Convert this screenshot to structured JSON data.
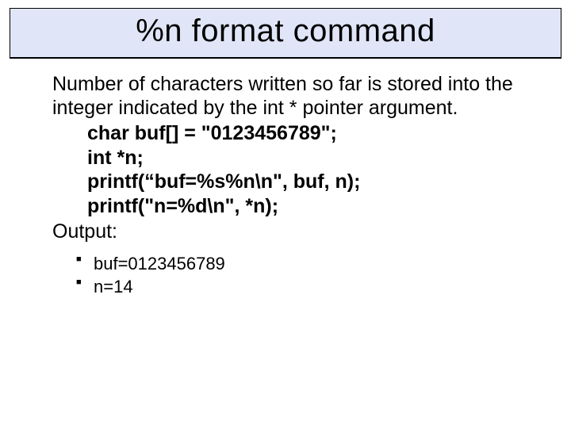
{
  "title": "%n format command",
  "description": "Number of characters written so far is stored into the integer indicated by the int * pointer argument.",
  "code": {
    "line1": "char buf[] = \"0123456789\";",
    "line2": "int *n;",
    "line3": "printf(“buf=%s%n\\n\", buf, n);",
    "line4": "printf(\"n=%d\\n\", *n);"
  },
  "output_label": "Output:",
  "output": {
    "line1": "buf=0123456789",
    "line2": "n=14"
  }
}
